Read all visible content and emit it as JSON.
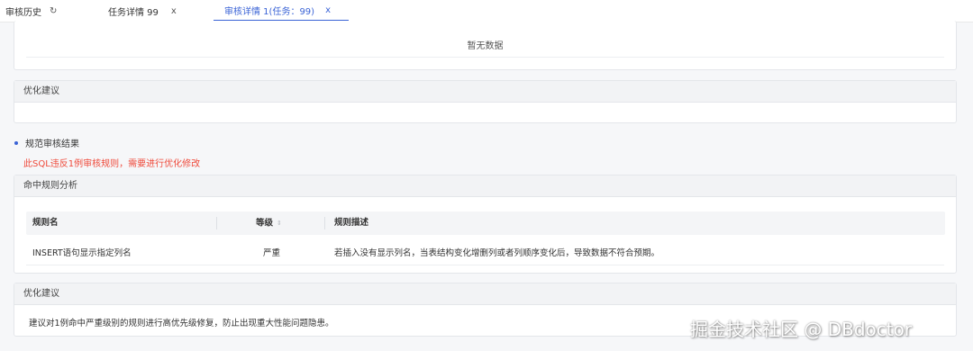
{
  "tabs": [
    {
      "label": "审核历史",
      "icon": "refresh-icon",
      "icon_glyph": "↻"
    },
    {
      "label": "任务详情 99",
      "icon": "close-icon",
      "icon_glyph": "x"
    },
    {
      "label": "审核详情 1(任务：99)",
      "icon": "close-icon",
      "icon_glyph": "x",
      "active": true
    }
  ],
  "top_card": {
    "empty_text": "暂无数据"
  },
  "optimize_card_1": {
    "title": "优化建议"
  },
  "standard_section": {
    "title": "规范审核结果",
    "violation_text": "此SQL违反1例审核规则，需要进行优化修改"
  },
  "rule_analysis": {
    "title": "命中规则分析",
    "columns": [
      "规则名",
      "等级",
      "规则描述"
    ],
    "rows": [
      {
        "name": "INSERT语句显示指定列名",
        "level": "严重",
        "description": "若插入没有显示列名，当表结构变化增删列或者列顺序变化后，导致数据不符合预期。"
      }
    ]
  },
  "optimize_card_2": {
    "title": "优化建议",
    "text": "建议对1例命中严重级别的规则进行高优先级修复，防止出现重大性能问题隐患。"
  },
  "watermark": "掘金技术社区 @ DBdoctor",
  "colors": {
    "accent": "#3a63d6",
    "error": "#ef4a3b",
    "header_bg": "#f2f3f5"
  }
}
